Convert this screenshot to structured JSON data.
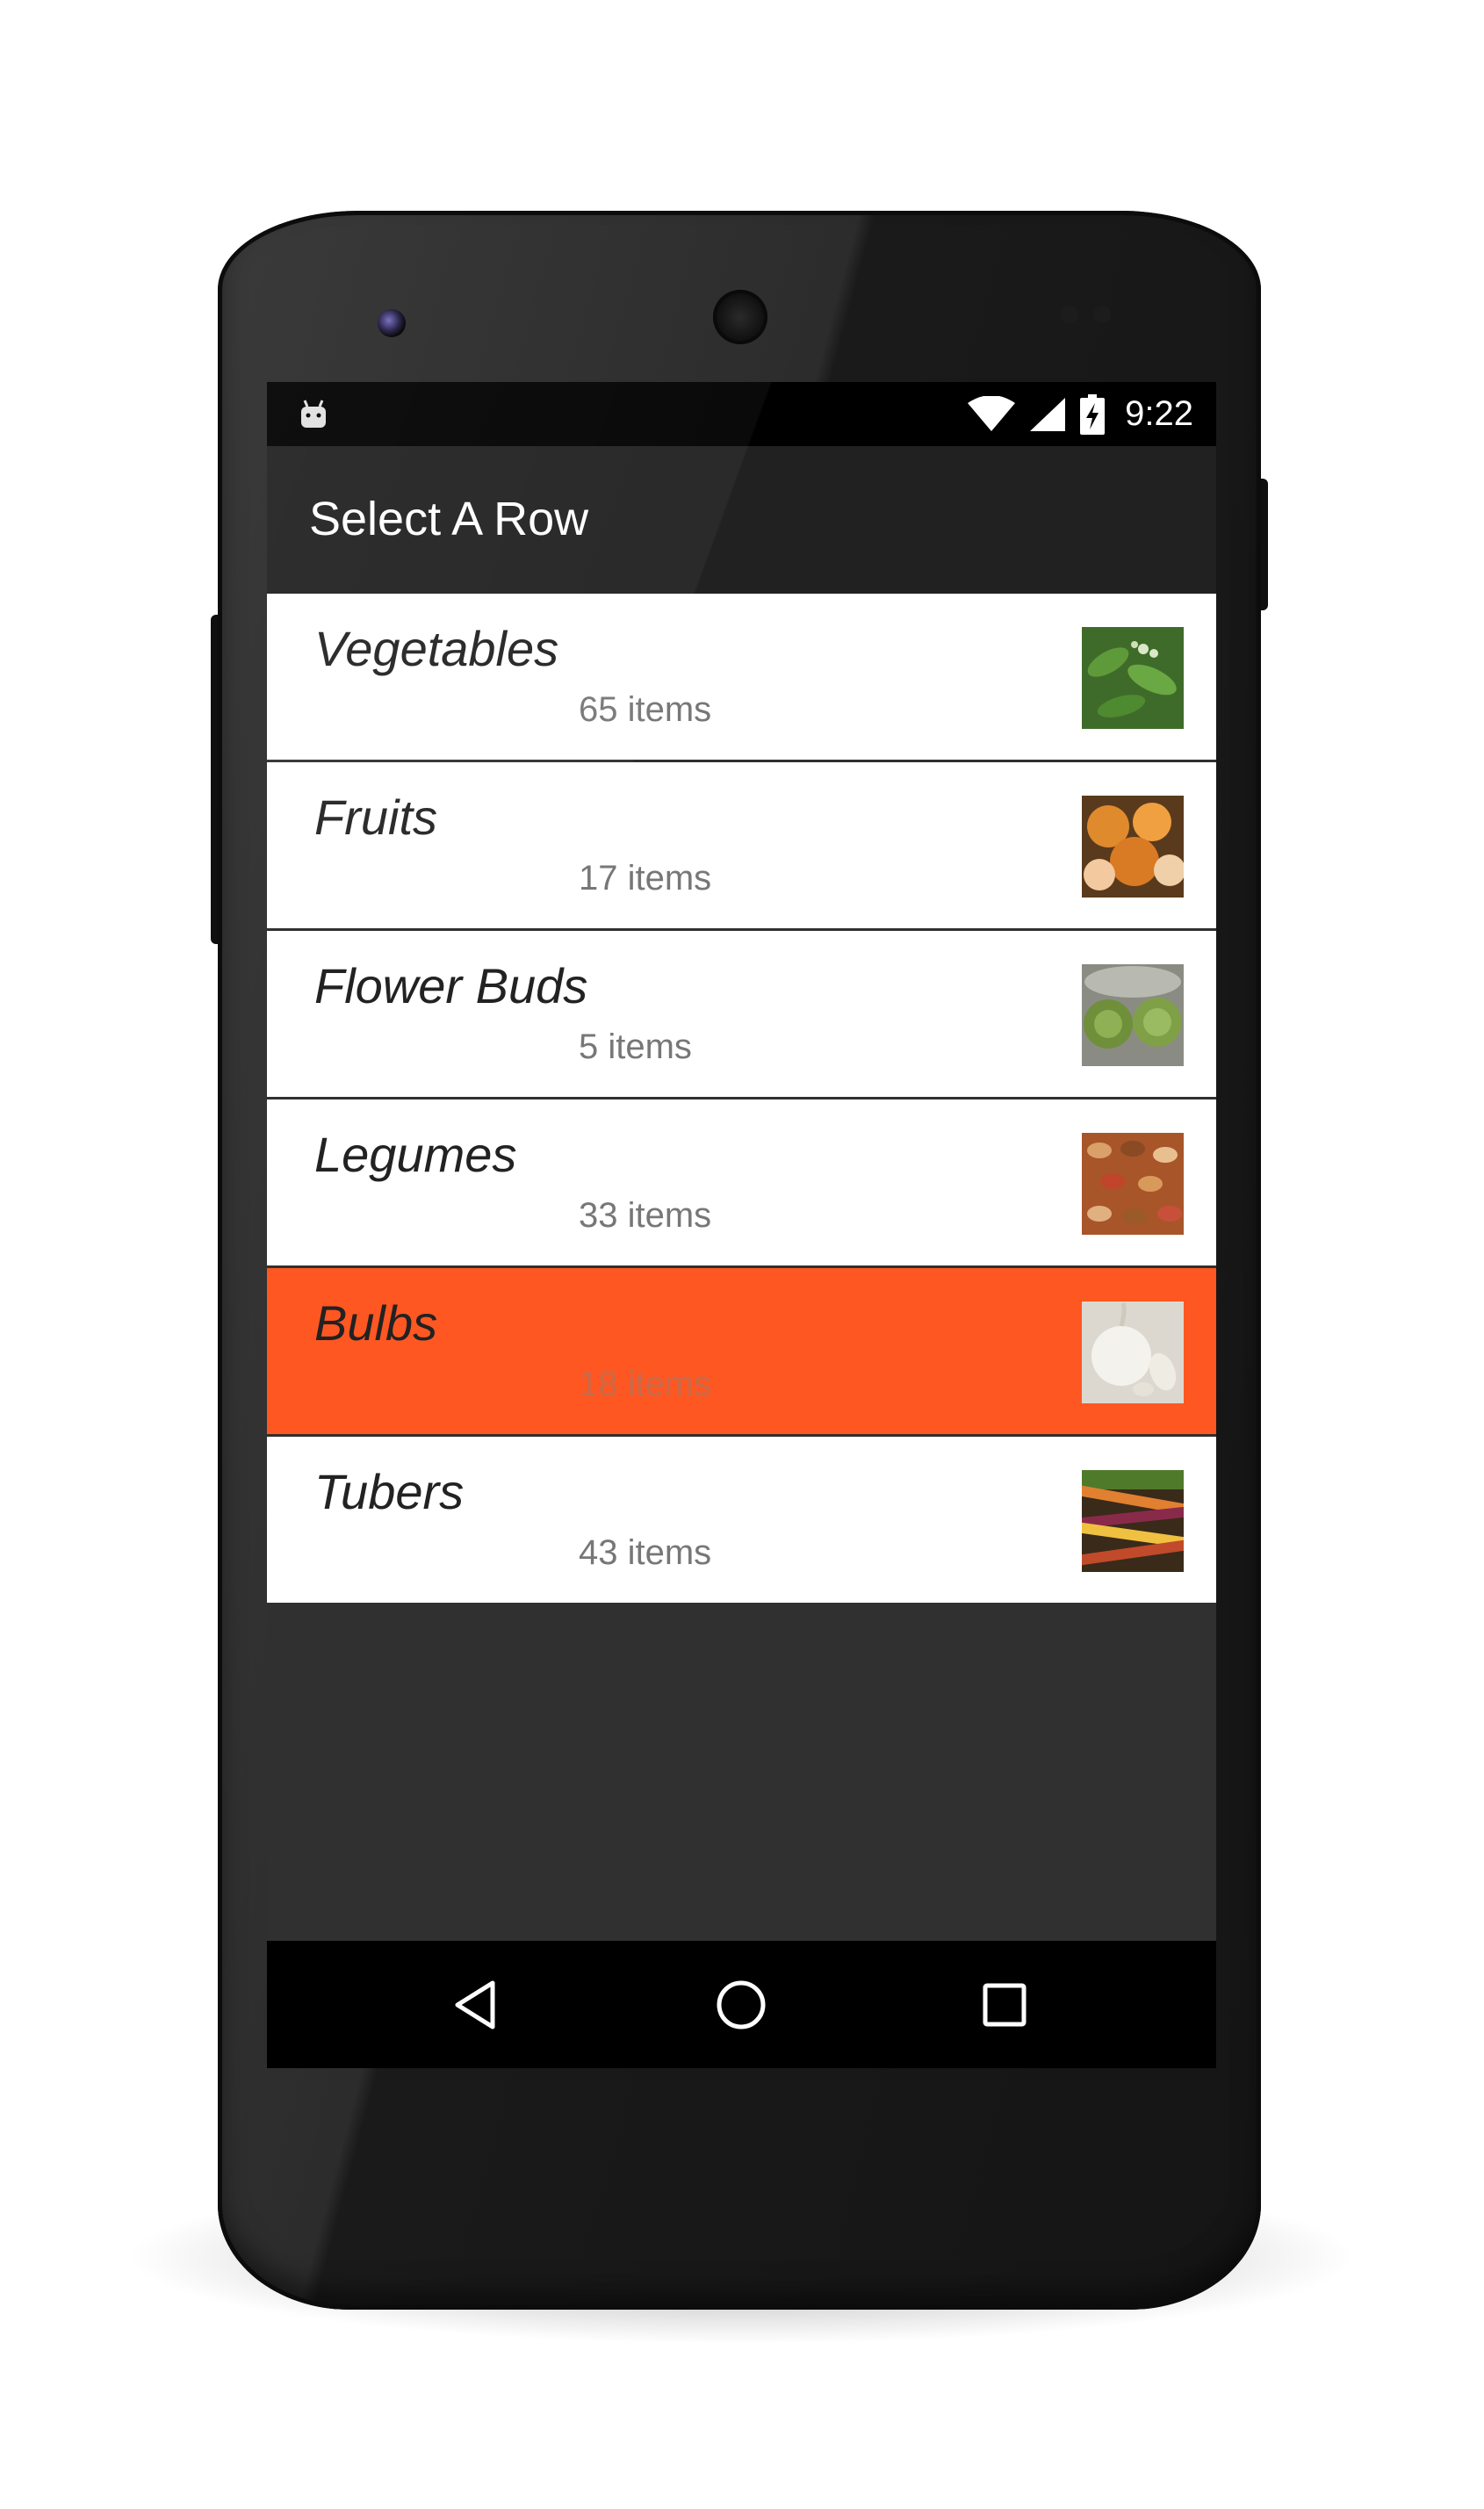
{
  "status_bar": {
    "time": "9:22",
    "icons": [
      "android-notification-icon",
      "wifi-icon",
      "cell-signal-icon",
      "battery-charging-icon"
    ]
  },
  "toolbar": {
    "title": "Select A Row"
  },
  "list": {
    "items": [
      {
        "title": "Vegetables",
        "subtitle": "65 items",
        "thumbnail": "vegetables-thumbnail",
        "selected": false
      },
      {
        "title": "Fruits",
        "subtitle": "17 items",
        "thumbnail": "fruits-thumbnail",
        "selected": false
      },
      {
        "title": "Flower Buds",
        "subtitle": "5 items",
        "thumbnail": "flower-buds-thumbnail",
        "selected": false
      },
      {
        "title": "Legumes",
        "subtitle": "33 items",
        "thumbnail": "legumes-thumbnail",
        "selected": false
      },
      {
        "title": "Bulbs",
        "subtitle": "18 items",
        "thumbnail": "bulbs-thumbnail",
        "selected": true
      },
      {
        "title": "Tubers",
        "subtitle": "43 items",
        "thumbnail": "tubers-thumbnail",
        "selected": false
      }
    ]
  },
  "nav_bar": {
    "buttons": [
      "back-icon",
      "home-icon",
      "recents-icon"
    ]
  },
  "colors": {
    "selected_row": "#ff5722",
    "toolbar": "#212121",
    "background": "#303030"
  }
}
